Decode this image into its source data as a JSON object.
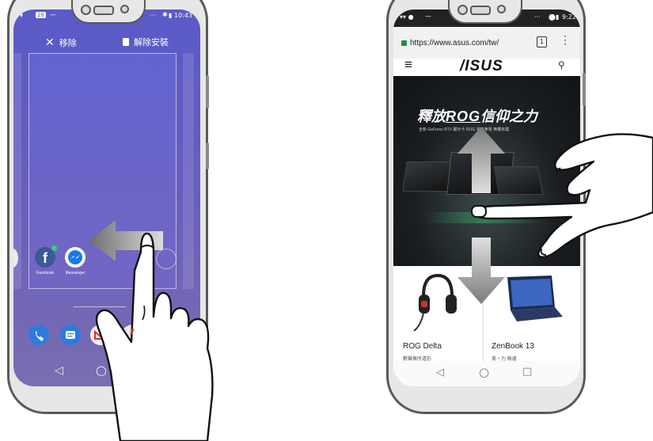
{
  "left_phone": {
    "status": {
      "time": "10:43",
      "notification_count": "28",
      "dash": "—",
      "dots": "···"
    },
    "top_bar": {
      "remove_label": "移除",
      "uninstall_label": "解除安裝"
    },
    "apps": [
      {
        "label": "Facebook"
      },
      {
        "label": "Messenger"
      }
    ],
    "nav": {
      "back": "◁",
      "home": "○"
    }
  },
  "right_phone": {
    "status": {
      "time": "9:22",
      "dash": "—",
      "dots": "···"
    },
    "browser": {
      "url": "https://www.asus.com/tw/",
      "tab_count": "1",
      "menu": "⋮"
    },
    "site": {
      "logo": "/ISUS",
      "menu_icon": "≡",
      "search_icon": "⚲"
    },
    "banner": {
      "title_prefix": "釋放",
      "title_brand": "ROG",
      "title_suffix": "信仰之力",
      "subtitle": "全新 GeForce RTX 顯示卡 ROG 電競筆電 無懼來襲"
    },
    "products": [
      {
        "name": "ROG Delta",
        "tagline": "數聲無所遁形"
      },
      {
        "name": "ZenBook 13",
        "tagline": "美・力 無邊"
      }
    ],
    "nav": {
      "back": "◁",
      "home": "○",
      "recents": "□"
    }
  },
  "colors": {
    "frame": "#5a5a5a",
    "launcher_top": "#5a5ac8",
    "launcher_bottom": "#7a6eb0",
    "banner": "#1b1e22",
    "url_lock": "#1e8e3e"
  }
}
